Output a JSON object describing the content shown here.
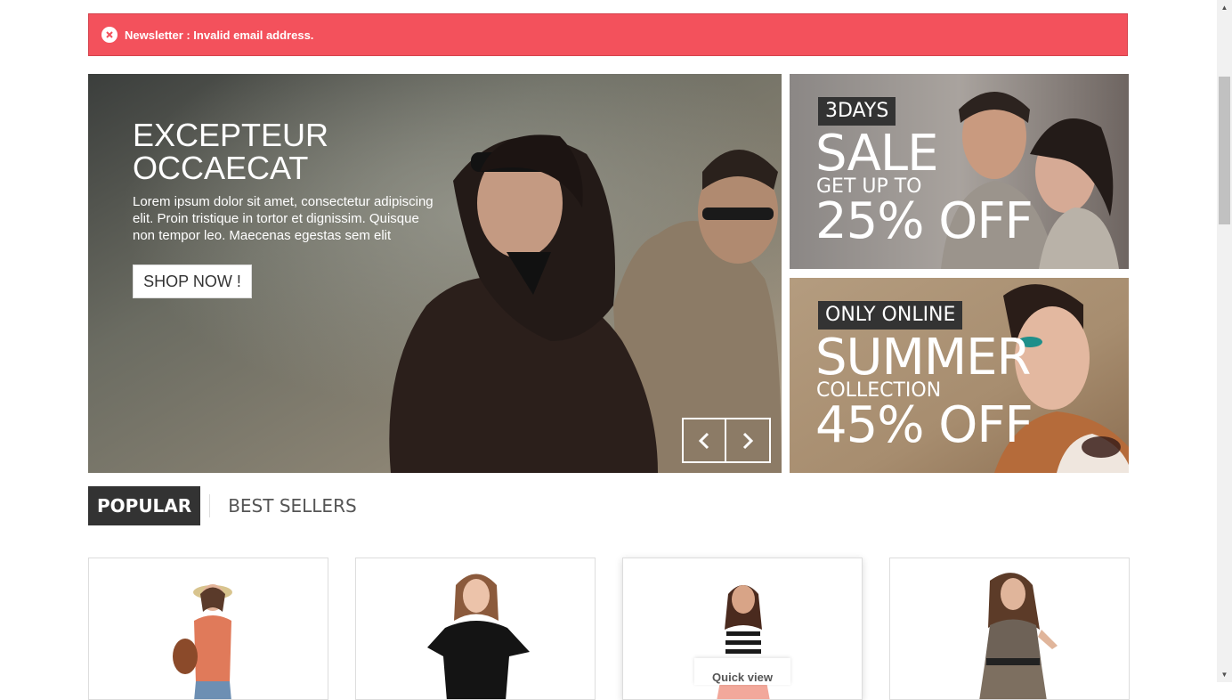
{
  "alert": {
    "text": "Newsletter : Invalid email address."
  },
  "slider": {
    "title": "EXCEPTEUR OCCAECAT",
    "text": "Lorem ipsum dolor sit amet, consectetur adipiscing elit. Proin tristique in tortor et dignissim. Quisque non tempor leo. Maecenas egestas sem elit",
    "button": "SHOP NOW !"
  },
  "banners": [
    {
      "tag": "3DAYS",
      "big": "SALE",
      "sub": "GET UP TO",
      "off": "25% OFF"
    },
    {
      "tag": "ONLY ONLINE",
      "big": "SUMMER",
      "sub": "COLLECTION",
      "off": "45% OFF"
    }
  ],
  "tabs": [
    {
      "label": "POPULAR"
    },
    {
      "label": "BEST SELLERS"
    }
  ],
  "products": {
    "quick_view": "Quick view"
  },
  "colors": {
    "alert": "#f3515c",
    "dark": "#333333"
  }
}
